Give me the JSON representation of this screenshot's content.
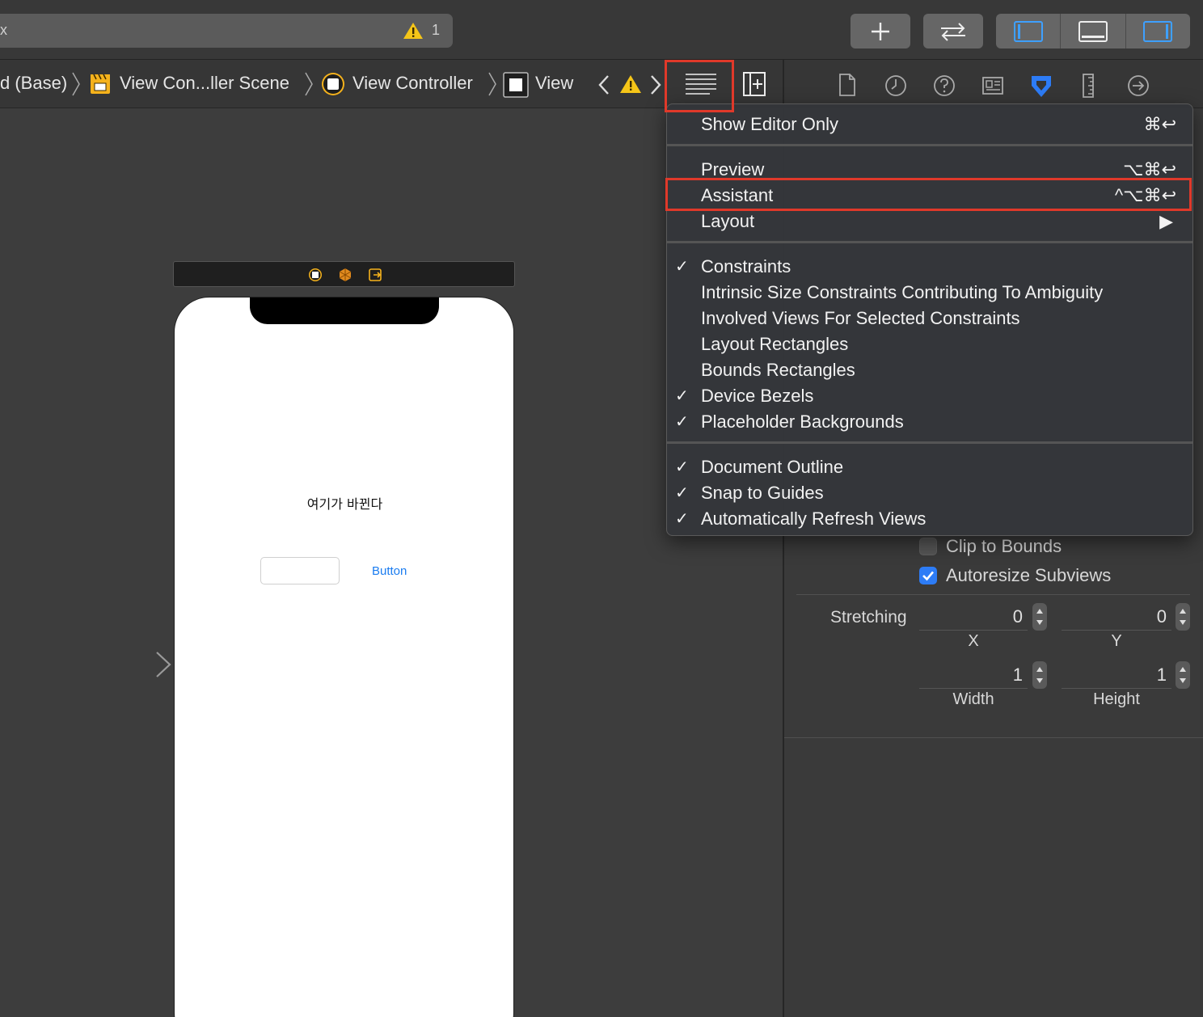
{
  "toolbar": {
    "activity_text": "x",
    "warning_count": "1",
    "add_label": "+",
    "swap_label": "⇄"
  },
  "jumpbar": {
    "crumbs": [
      "d (Base)",
      "View Con...ller Scene",
      "View Controller",
      "View"
    ]
  },
  "canvas": {
    "label_text": "여기가 바뀐다",
    "button_text": "Button"
  },
  "menu": {
    "items": [
      {
        "label": "Show Editor Only",
        "shortcut": "⌘↩",
        "checked": false
      },
      {
        "label": "Preview",
        "shortcut": "⌥⌘↩",
        "checked": false
      },
      {
        "label": "Assistant",
        "shortcut": "^⌥⌘↩",
        "checked": false
      },
      {
        "label": "Layout",
        "shortcut": "▶",
        "checked": false
      },
      {
        "label": "Constraints",
        "shortcut": "",
        "checked": true
      },
      {
        "label": "Intrinsic Size Constraints Contributing To Ambiguity",
        "shortcut": "",
        "checked": false
      },
      {
        "label": "Involved Views For Selected Constraints",
        "shortcut": "",
        "checked": false
      },
      {
        "label": "Layout Rectangles",
        "shortcut": "",
        "checked": false
      },
      {
        "label": "Bounds Rectangles",
        "shortcut": "",
        "checked": false
      },
      {
        "label": "Device Bezels",
        "shortcut": "",
        "checked": true
      },
      {
        "label": "Placeholder Backgrounds",
        "shortcut": "",
        "checked": true
      },
      {
        "label": "Document Outline",
        "shortcut": "",
        "checked": true
      },
      {
        "label": "Snap to Guides",
        "shortcut": "",
        "checked": true
      },
      {
        "label": "Automatically Refresh Views",
        "shortcut": "",
        "checked": true
      }
    ],
    "check_glyph": "✓"
  },
  "inspector": {
    "clip_to_bounds": "Clip to Bounds",
    "clip_checked": false,
    "autoresize": "Autoresize Subviews",
    "autoresize_checked": true,
    "stretching_label": "Stretching",
    "x_value": "0",
    "y_value": "0",
    "width_value": "1",
    "height_value": "1",
    "x_label": "X",
    "y_label": "Y",
    "width_label": "Width",
    "height_label": "Height"
  },
  "colors": {
    "accent": "#2d7cf6",
    "highlight_box": "#e0392a",
    "warning": "#f5c518"
  }
}
